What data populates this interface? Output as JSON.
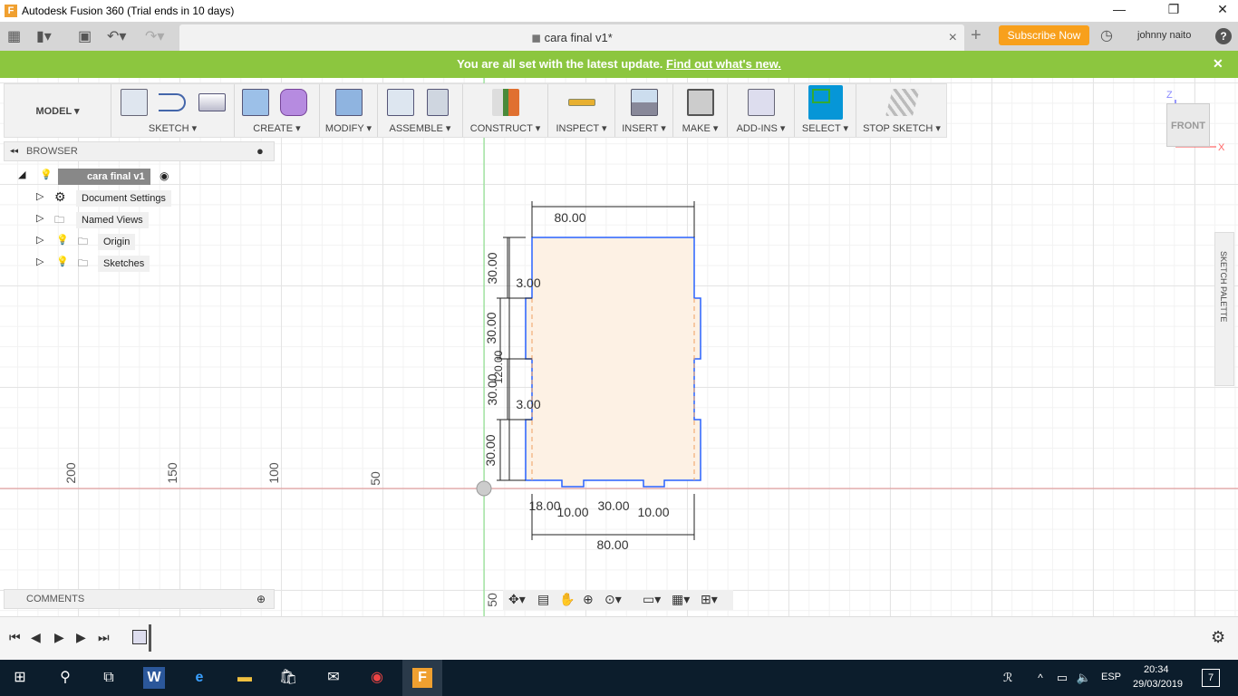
{
  "window": {
    "title": "Autodesk Fusion 360 (Trial ends in 10 days)",
    "minimize": "—",
    "maximize": "❐",
    "close": "✕"
  },
  "quickbar": {
    "doc_tab": "cara final v1*",
    "tab_close": "×",
    "new_tab": "+",
    "subscribe": "Subscribe Now",
    "user": "johnny naito",
    "help": "?"
  },
  "notification": {
    "message": "You are all set with the latest update.",
    "link": "Find out what's new.",
    "close": "✕"
  },
  "toolbar": {
    "workspace": "MODEL ▾",
    "groups": [
      "SKETCH ▾",
      "CREATE ▾",
      "MODIFY ▾",
      "ASSEMBLE ▾",
      "CONSTRUCT ▾",
      "INSPECT ▾",
      "INSERT ▾",
      "MAKE ▾",
      "ADD-INS ▾",
      "SELECT ▾",
      "STOP SKETCH ▾"
    ],
    "select_color": "#0696d7"
  },
  "browser": {
    "title": "BROWSER",
    "root": "cara final v1",
    "items": [
      "Document Settings",
      "Named Views",
      "Origin",
      "Sketches"
    ]
  },
  "comments": {
    "title": "COMMENTS"
  },
  "sketch_palette": {
    "label": "SKETCH PALETTE"
  },
  "viewcube": {
    "face": "FRONT",
    "z": "Z",
    "x": "X"
  },
  "axis_labels": [
    "200",
    "150",
    "100",
    "50",
    "50"
  ],
  "sketch": {
    "dims": {
      "top_width": "80.00",
      "bottom_width": "80.00",
      "v1": "30.00",
      "v2": "30.00",
      "v3": "30.00",
      "v4": "30.00",
      "tab1": "3.00",
      "tab2": "3.00",
      "total": "120.00",
      "b1": "18.00",
      "b2": "10.00",
      "b3": "30.00",
      "b4": "10.00"
    },
    "profile_fill": "#fdf1e4",
    "line_color": "#2962ff"
  },
  "taskbar": {
    "time": "20:34",
    "date": "29/03/2019",
    "lang": "ESP",
    "notifications": "7"
  }
}
